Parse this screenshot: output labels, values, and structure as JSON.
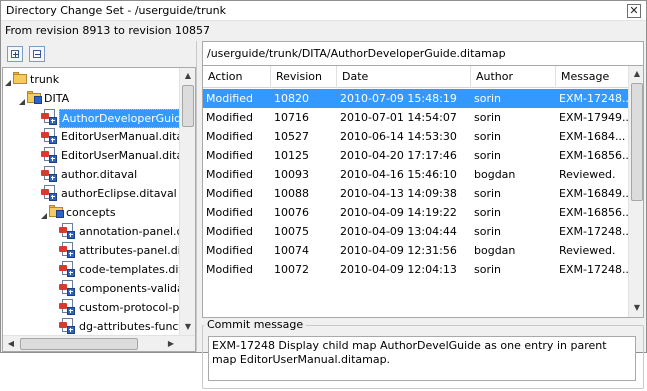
{
  "window": {
    "title": "Directory Change Set - /userguide/trunk",
    "close_label": "✕"
  },
  "revision_range": "From revision 8913 to revision 10857",
  "toolbar": {
    "expand_all": "expand-all-icon",
    "collapse_all": "collapse-all-icon"
  },
  "tree": {
    "nodes": [
      {
        "label": "trunk",
        "type": "folder",
        "level": 0,
        "expanded": true
      },
      {
        "label": "DITA",
        "type": "folder-changed",
        "level": 1,
        "expanded": true
      },
      {
        "label": "AuthorDeveloperGuide.ditamap",
        "type": "file",
        "level": 2,
        "selected": true
      },
      {
        "label": "EditorUserManual.ditamap",
        "type": "file",
        "level": 2
      },
      {
        "label": "EditorUserManual.ditaval",
        "type": "file",
        "level": 2
      },
      {
        "label": "author.ditaval",
        "type": "file",
        "level": 2
      },
      {
        "label": "authorEclipse.ditaval",
        "type": "file",
        "level": 2
      },
      {
        "label": "concepts",
        "type": "folder-changed",
        "level": 2,
        "expanded": true
      },
      {
        "label": "annotation-panel.dita",
        "type": "file",
        "level": 3
      },
      {
        "label": "attributes-panel.dita",
        "type": "file",
        "level": 3
      },
      {
        "label": "code-templates.dita",
        "type": "file",
        "level": 3
      },
      {
        "label": "components-validation.dita",
        "type": "file",
        "level": 3
      },
      {
        "label": "custom-protocol-plugin.dita",
        "type": "file",
        "level": 3
      },
      {
        "label": "dg-attributes-functions.dita",
        "type": "file",
        "level": 3
      }
    ]
  },
  "path": "/userguide/trunk/DITA/AuthorDeveloperGuide.ditamap",
  "history": {
    "columns": [
      "Action",
      "Revision",
      "Date",
      "Author",
      "Message"
    ],
    "rows": [
      {
        "action": "Modified",
        "revision": "10820",
        "date": "2010-07-09 15:48:19",
        "author": "sorin",
        "message": "EXM-17248...",
        "selected": true
      },
      {
        "action": "Modified",
        "revision": "10716",
        "date": "2010-07-01 14:54:07",
        "author": "sorin",
        "message": "EXM-17949..."
      },
      {
        "action": "Modified",
        "revision": "10527",
        "date": "2010-06-14 14:53:30",
        "author": "sorin",
        "message": " EXM-1684..."
      },
      {
        "action": "Modified",
        "revision": "10125",
        "date": "2010-04-20 17:17:46",
        "author": "sorin",
        "message": "EXM-16856..."
      },
      {
        "action": "Modified",
        "revision": "10093",
        "date": "2010-04-16 15:46:10",
        "author": "bogdan",
        "message": "Reviewed."
      },
      {
        "action": "Modified",
        "revision": "10088",
        "date": "2010-04-13 14:09:38",
        "author": "sorin",
        "message": "EXM-16849..."
      },
      {
        "action": "Modified",
        "revision": "10076",
        "date": "2010-04-09 14:19:22",
        "author": "sorin",
        "message": "EXM-16856..."
      },
      {
        "action": "Modified",
        "revision": "10075",
        "date": "2010-04-09 13:04:44",
        "author": "sorin",
        "message": "EXM-17248..."
      },
      {
        "action": "Modified",
        "revision": "10074",
        "date": "2010-04-09 12:31:56",
        "author": "bogdan",
        "message": "Reviewed."
      },
      {
        "action": "Modified",
        "revision": "10072",
        "date": "2010-04-09 12:04:13",
        "author": "sorin",
        "message": "EXM-17248..."
      }
    ]
  },
  "commit": {
    "label": "Commit message",
    "text": "EXM-17248 Display child map AuthorDevelGuide as one entry in parent map EditorUserManual.ditamap."
  },
  "colors": {
    "selection": "#3399ff",
    "folder": "#f3cc5c",
    "file_mark": "#d93a2e",
    "change_badge": "#2c64c6"
  }
}
